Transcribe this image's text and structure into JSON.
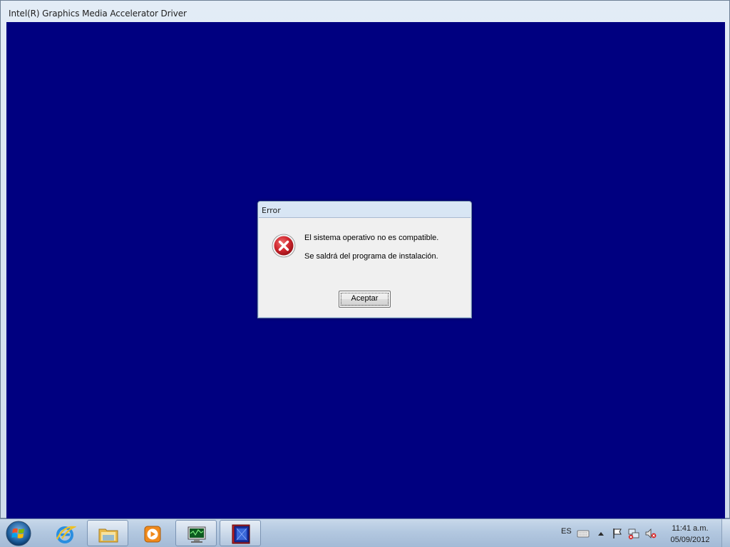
{
  "main_window": {
    "title": "Intel(R) Graphics Media Accelerator Driver"
  },
  "dialog": {
    "title": "Error",
    "message_line1": "El sistema operativo no es compatible.",
    "message_line2": "Se saldrá del programa de instalación.",
    "ok_label": "Aceptar",
    "icon": "error-icon"
  },
  "taskbar": {
    "pinned": [
      {
        "name": "internet-explorer-icon"
      },
      {
        "name": "file-explorer-icon"
      },
      {
        "name": "media-player-icon"
      }
    ],
    "running": [
      {
        "name": "installer-monitor-icon"
      },
      {
        "name": "intel-setup-icon"
      }
    ],
    "tray": {
      "language": "ES",
      "icons": [
        "keyboard-icon",
        "show-hidden-icons-arrow",
        "action-center-flag-icon",
        "network-icon",
        "volume-muted-icon"
      ]
    },
    "clock": {
      "time": "11:41 a.m.",
      "date": "05/09/2012"
    }
  },
  "colors": {
    "client_background": "#000080",
    "error_red": "#c8202a"
  }
}
